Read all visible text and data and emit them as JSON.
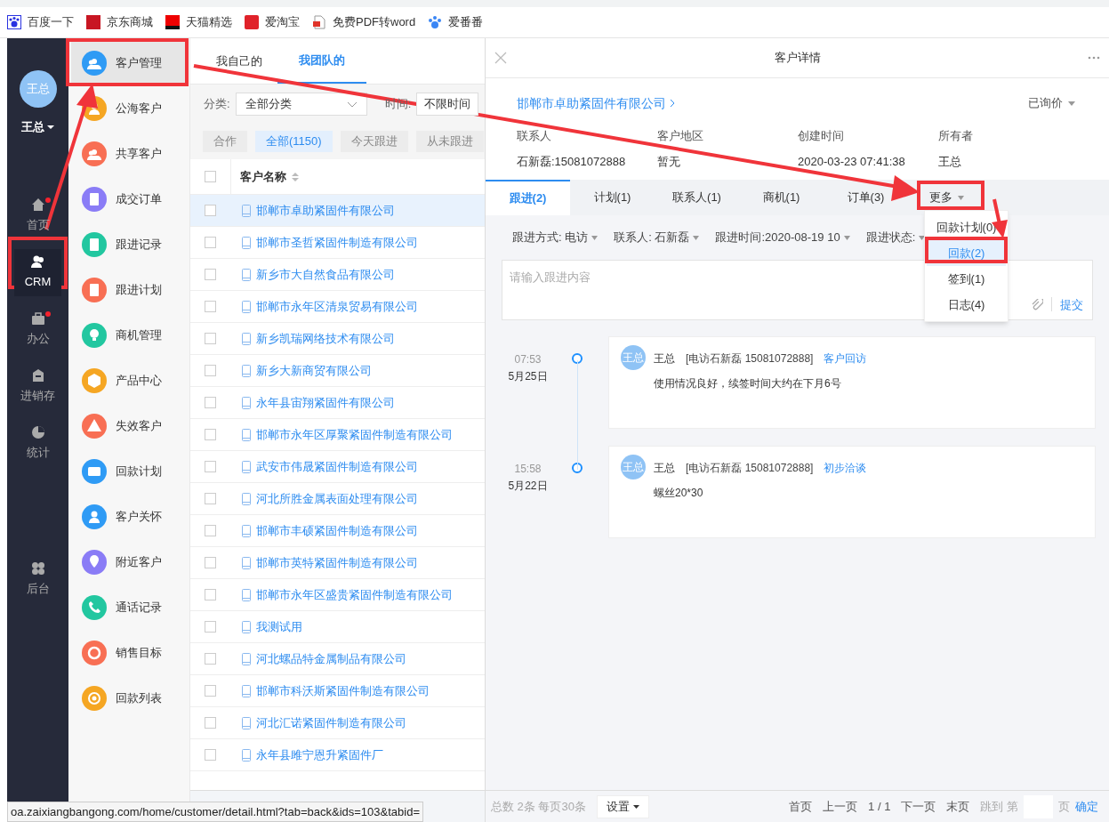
{
  "bookmarks": [
    {
      "label": "百度一下"
    },
    {
      "label": "京东商城"
    },
    {
      "label": "天猫精选"
    },
    {
      "label": "爱淘宝"
    },
    {
      "label": "免费PDF转word"
    },
    {
      "label": "爱番番"
    }
  ],
  "nav": {
    "avatar": "王总",
    "user": "王总",
    "items": [
      {
        "label": "首页",
        "selected": false,
        "notification": true
      },
      {
        "label": "CRM",
        "selected": true,
        "notification": false
      },
      {
        "label": "办公",
        "selected": false,
        "notification": true
      },
      {
        "label": "进销存",
        "selected": false,
        "notification": false
      },
      {
        "label": "统计",
        "selected": false,
        "notification": false
      }
    ],
    "footer_item": {
      "label": "后台",
      "selected": false,
      "notification": false
    }
  },
  "submenu": [
    {
      "label": "客户管理",
      "selected": true,
      "color": "#2f9bf5"
    },
    {
      "label": "公海客户",
      "selected": false,
      "color": "#f5a623"
    },
    {
      "label": "共享客户",
      "selected": false,
      "color": "#f86f54"
    },
    {
      "label": "成交订单",
      "selected": false,
      "color": "#8a7cf6"
    },
    {
      "label": "跟进记录",
      "selected": false,
      "color": "#22c7a0"
    },
    {
      "label": "跟进计划",
      "selected": false,
      "color": "#f86f54"
    },
    {
      "label": "商机管理",
      "selected": false,
      "color": "#22c7a0"
    },
    {
      "label": "产品中心",
      "selected": false,
      "color": "#f5a623"
    },
    {
      "label": "失效客户",
      "selected": false,
      "color": "#f86f54"
    },
    {
      "label": "回款计划",
      "selected": false,
      "color": "#2f9bf5"
    },
    {
      "label": "客户关怀",
      "selected": false,
      "color": "#2f9bf5"
    },
    {
      "label": "附近客户",
      "selected": false,
      "color": "#8a7cf6"
    },
    {
      "label": "通话记录",
      "selected": false,
      "color": "#22c7a0"
    },
    {
      "label": "销售目标",
      "selected": false,
      "color": "#f86f54"
    },
    {
      "label": "回款列表",
      "selected": false,
      "color": "#f5a623"
    }
  ],
  "list": {
    "tabs": [
      {
        "label": "我自己的",
        "selected": false
      },
      {
        "label": "我团队的",
        "selected": true
      }
    ],
    "category_label": "分类:",
    "category_value": "全部分类",
    "time_label": "时间:",
    "time_value": "不限时间",
    "chips": [
      {
        "label": "合作",
        "selected": false
      },
      {
        "label": "全部(1150)",
        "selected": true
      },
      {
        "label": "今天跟进",
        "selected": false
      },
      {
        "label": "从未跟进",
        "selected": false
      }
    ],
    "column": "客户名称",
    "all_checked": false,
    "rows": [
      {
        "name": "邯郸市卓助紧固件有限公司",
        "selected": true,
        "checked": false
      },
      {
        "name": "邯郸市圣哲紧固件制造有限公司",
        "selected": false,
        "checked": false
      },
      {
        "name": "新乡市大自然食品有限公司",
        "selected": false,
        "checked": false
      },
      {
        "name": "邯郸市永年区清泉贸易有限公司",
        "selected": false,
        "checked": false
      },
      {
        "name": "新乡凯瑞网络技术有限公司",
        "selected": false,
        "checked": false
      },
      {
        "name": "新乡大新商贸有限公司",
        "selected": false,
        "checked": false
      },
      {
        "name": "永年县宙翔紧固件有限公司",
        "selected": false,
        "checked": false
      },
      {
        "name": "邯郸市永年区厚聚紧固件制造有限公司",
        "selected": false,
        "checked": false
      },
      {
        "name": "武安市伟晟紧固件制造有限公司",
        "selected": false,
        "checked": false
      },
      {
        "name": "河北所胜金属表面处理有限公司",
        "selected": false,
        "checked": false
      },
      {
        "name": "邯郸市丰硕紧固件制造有限公司",
        "selected": false,
        "checked": false
      },
      {
        "name": "邯郸市英特紧固件制造有限公司",
        "selected": false,
        "checked": false
      },
      {
        "name": "邯郸市永年区盛贵紧固件制造有限公司",
        "selected": false,
        "checked": false
      },
      {
        "name": "我测试用",
        "selected": false,
        "checked": false
      },
      {
        "name": "河北螺品特金属制品有限公司",
        "selected": false,
        "checked": false
      },
      {
        "name": "邯郸市科沃斯紧固件制造有限公司",
        "selected": false,
        "checked": false
      },
      {
        "name": "河北汇诺紧固件制造有限公司",
        "selected": false,
        "checked": false
      },
      {
        "name": "永年县雎宁恩升紧固件厂",
        "selected": false,
        "checked": false
      }
    ]
  },
  "detail": {
    "title": "客户详情",
    "company": "邯郸市卓助紧固件有限公司",
    "stage": "已询价",
    "info": [
      {
        "label": "联系人",
        "value": "石新磊:15081072888"
      },
      {
        "label": "客户地区",
        "value": "暂无"
      },
      {
        "label": "创建时间",
        "value": "2020-03-23 07:41:38"
      },
      {
        "label": "所有者",
        "value": "王总"
      }
    ],
    "tabs": [
      {
        "label": "跟进(2)",
        "selected": true
      },
      {
        "label": "计划(1)",
        "selected": false
      },
      {
        "label": "联系人(1)",
        "selected": false
      },
      {
        "label": "商机(1)",
        "selected": false
      },
      {
        "label": "订单(3)",
        "selected": false
      },
      {
        "label": "更多",
        "selected": false
      }
    ],
    "more_menu": [
      {
        "label": "回款计划(0)",
        "selected": false
      },
      {
        "label": "回款(2)",
        "selected": true
      },
      {
        "label": "签到(1)",
        "selected": false
      },
      {
        "label": "日志(4)",
        "selected": false
      }
    ],
    "filters": [
      "跟进方式: 电访",
      "联系人: 石新磊",
      "跟进时间:2020-08-19 10",
      "跟进状态:"
    ],
    "placeholder": "请输入跟进内容",
    "submit": "提交",
    "timeline": [
      {
        "time": "07:53",
        "date": "5月25日",
        "avatar": "王总",
        "author": "王总",
        "contact": "[电访石新磊 15081072888]",
        "tag": "客户回访",
        "text": "使用情况良好，续签时间大约在下月6号"
      },
      {
        "time": "15:58",
        "date": "5月22日",
        "avatar": "王总",
        "author": "王总",
        "contact": "[电访石新磊 15081072888]",
        "tag": "初步洽谈",
        "text": "螺丝20*30"
      }
    ],
    "total": "总数 2条 每页30条",
    "settings": "设置",
    "pager": [
      "首页",
      "上一页",
      "1 / 1",
      "下一页",
      "末页"
    ],
    "jump_label": "跳到 第",
    "page_label": "页",
    "confirm": "确定"
  },
  "status_url": "oa.zaixiangbangong.com/home/customer/detail.html?tab=back&ids=103&tabid="
}
